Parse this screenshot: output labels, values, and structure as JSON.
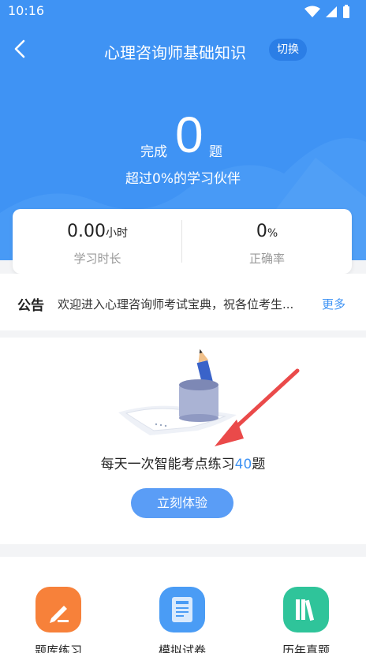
{
  "status_bar": {
    "time": "10:16"
  },
  "nav": {
    "title": "心理咨询师基础知识",
    "switch_label": "切换"
  },
  "progress": {
    "completed_label": "完成",
    "completed_count": "0",
    "completed_unit": "题",
    "beats_text": "超过0%的学习伙伴"
  },
  "stats": {
    "study_time": {
      "value": "0.00",
      "unit": "小时",
      "label": "学习时长"
    },
    "accuracy": {
      "value": "0",
      "unit": "%",
      "label": "正确率"
    }
  },
  "notice": {
    "tag": "公告",
    "text": "欢迎进入心理咨询师考试宝典，祝各位考生...",
    "more_label": "更多"
  },
  "daily_practice": {
    "text_prefix": "每天一次智能考点练习",
    "count": "40",
    "text_suffix": "题",
    "button_label": "立刻体验"
  },
  "modules": [
    {
      "label": "题库练习",
      "icon": "pencil-paper-icon",
      "color": "#f7813a"
    },
    {
      "label": "模拟试卷",
      "icon": "test-paper-icon",
      "color": "#4a9cf5"
    },
    {
      "label": "历年真题",
      "icon": "books-icon",
      "color": "#2fc49a"
    }
  ],
  "colors": {
    "primary": "#3f93f4",
    "accent_arrow": "#ea4a4a"
  }
}
